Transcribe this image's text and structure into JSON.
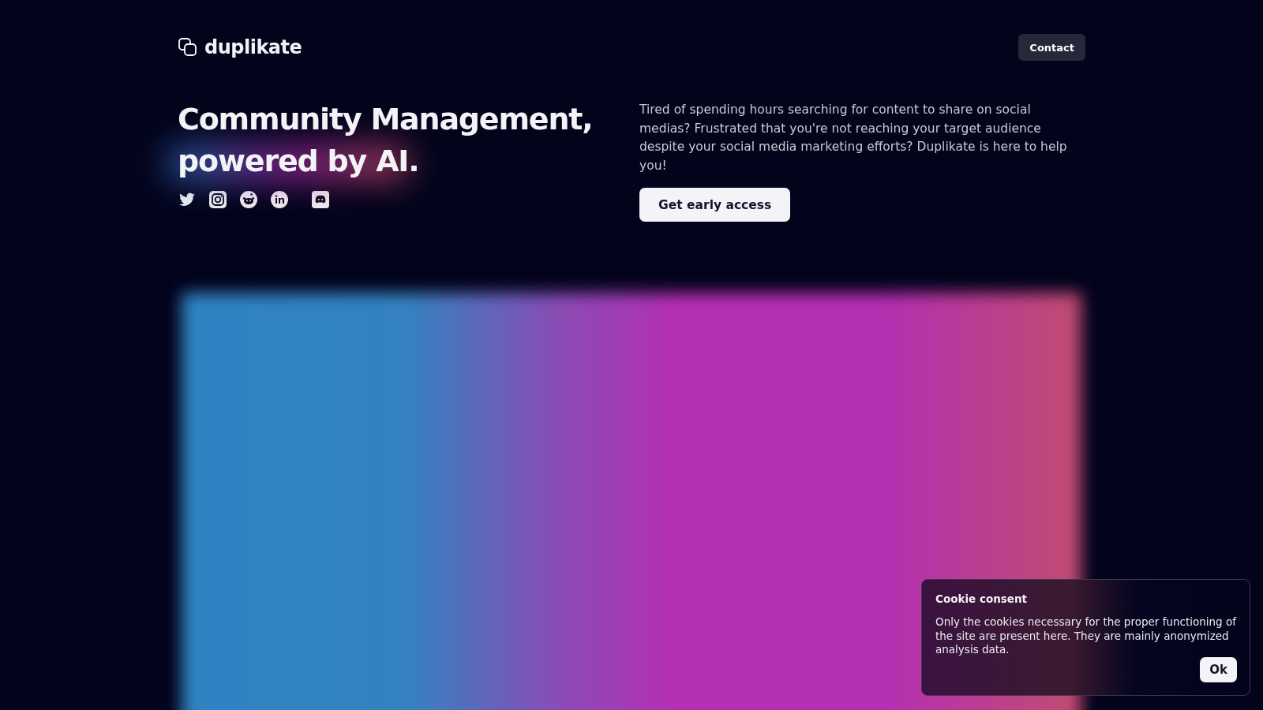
{
  "header": {
    "logo_text": "duplikate",
    "contact_button": "Contact"
  },
  "hero": {
    "headline_line_1": "Community Management,",
    "headline_line_2": "powered by AI.",
    "description": "Tired of spending hours searching for content to share on social medias? Frustrated that you're not reaching your target audience despite your social media marketing efforts? Duplikate is here to help you!",
    "cta_button": "Get early access"
  },
  "cookie_consent": {
    "title": "Cookie consent",
    "message": "Only the cookies necessary for the proper functioning of the site are present here. They are mainly anonymized analysis data.",
    "button": "Ok"
  }
}
